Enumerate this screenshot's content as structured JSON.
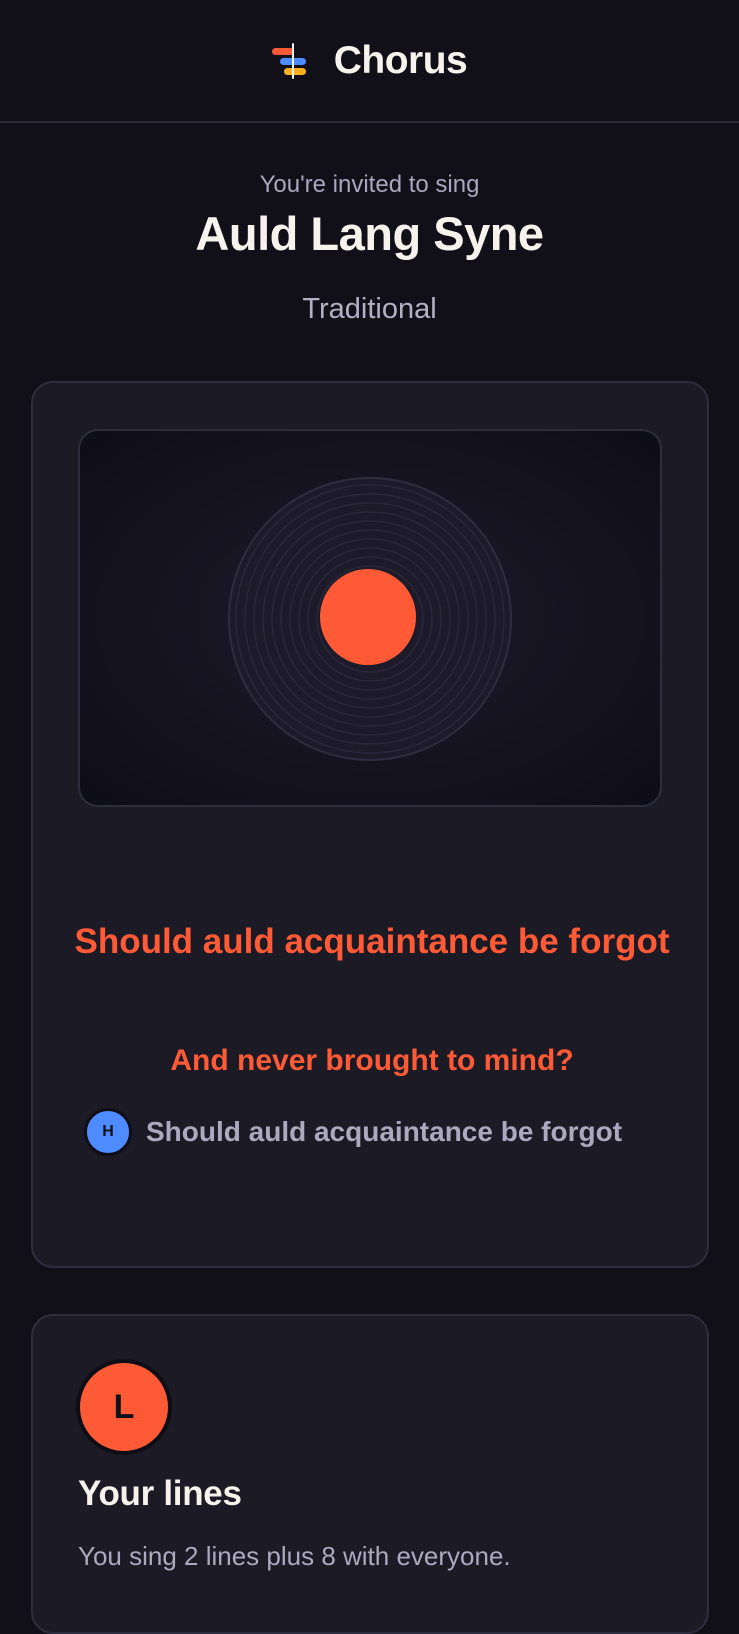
{
  "header": {
    "brand": "Chorus",
    "logo_icon": "chorus-logo-icon"
  },
  "invite": {
    "prompt": "You're invited to sing",
    "song_title": "Auld Lang Syne",
    "artist": "Traditional"
  },
  "player": {
    "artwork_icon": "vinyl-record-icon",
    "current_lyric": "Should auld acquaintance be forgot",
    "next_lyric": "And never brought to mind?",
    "other_singer": {
      "initial": "H",
      "line": "Should auld acquaintance be forgot",
      "color": "#4d8bff"
    }
  },
  "your_lines": {
    "initial": "L",
    "title": "Your lines",
    "description": "You sing 2 lines plus 8 with everyone."
  },
  "colors": {
    "accent": "#ff5a36",
    "background": "#111019",
    "card": "#1b1a25"
  }
}
